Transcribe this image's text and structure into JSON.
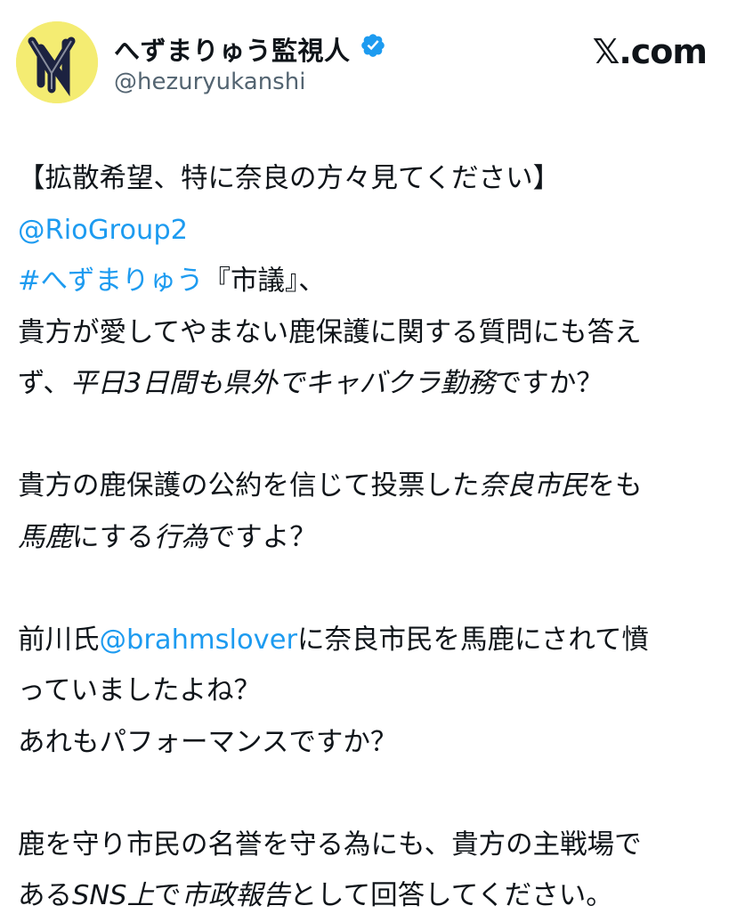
{
  "header": {
    "display_name": "へずまりゅう監視人",
    "handle": "@hezuryukanshi",
    "brand": "𝕏.com",
    "avatar_icon": "ny-logo-avatar",
    "verified_icon": "verified-badge-icon",
    "verified_color": "#1d9bf0"
  },
  "tweet": {
    "line1": "【拡散希望、特に奈良の方々見てください】",
    "mention1": "@RioGroup2",
    "hashtag": "#へずまりゅう",
    "line3_rest": "『市議』、",
    "line4": "貴方が愛してやまない鹿保護に関する質問にも答え",
    "line5a": "ず、",
    "line5b": "平日3日間も県外でキャバクラ勤務",
    "line5c": "ですか？",
    "line6a": "貴方の鹿保護の公約を信じて投票した",
    "line6b": "奈良市民",
    "line6c": "をも",
    "line7a": "馬鹿",
    "line7b": "にする",
    "line7c": "行為",
    "line7d": "ですよ？",
    "line8a": "前川氏",
    "mention2": "@brahmslover",
    "line8b": "に奈良市民を馬鹿にされて憤",
    "line9": "っていましたよね？",
    "line10": "あれもパフォーマンスですか？",
    "line11": "鹿を守り市民の名誉を守る為にも、貴方の主戦場で",
    "line12a": "ある",
    "line12b": "SNS上",
    "line12c": "で",
    "line12d": "市政報告",
    "line12e": "として回答してください。"
  },
  "colors": {
    "link": "#1d9bf0",
    "text": "#0f1419",
    "secondary": "#536471",
    "avatar_bg": "#f4ec72"
  }
}
